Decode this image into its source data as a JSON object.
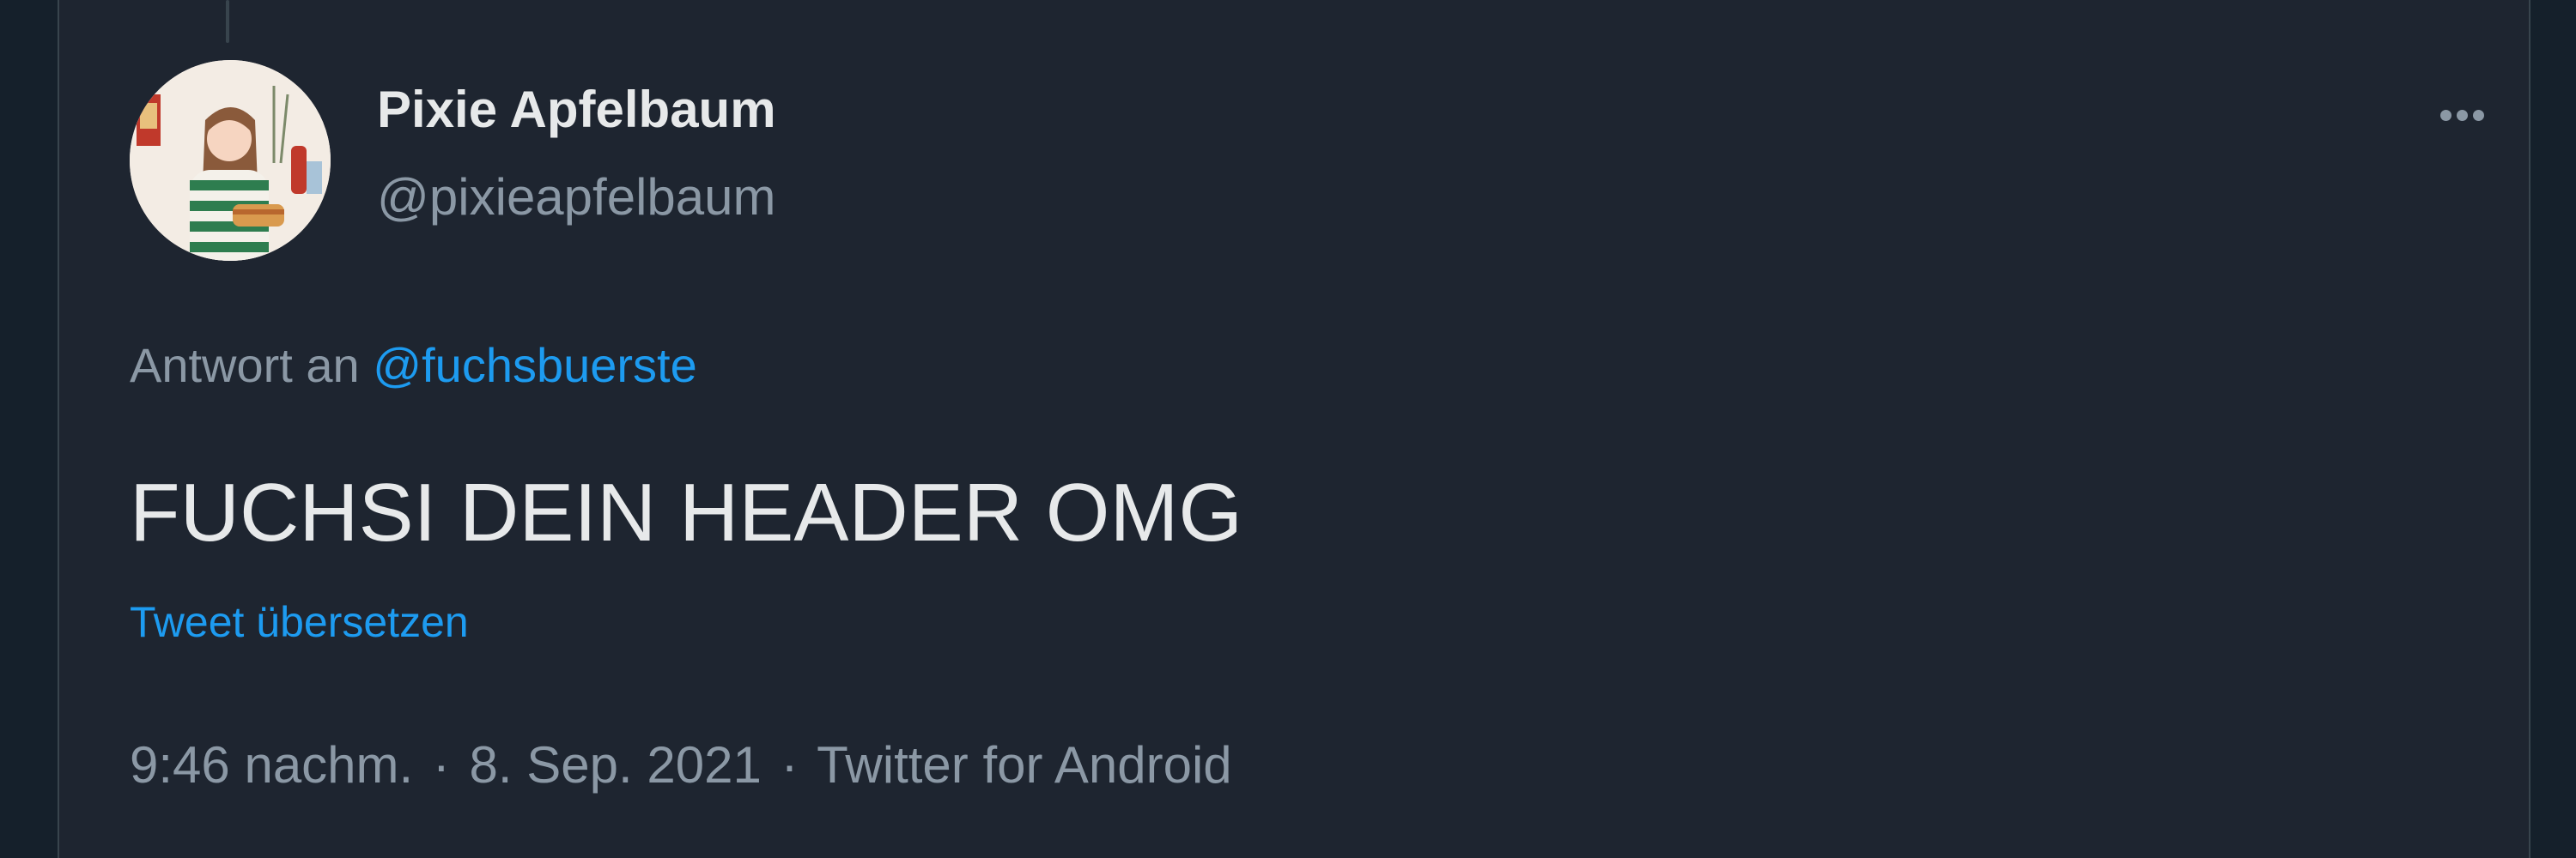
{
  "author": {
    "display_name": "Pixie Apfelbaum",
    "handle": "@pixieapfelbaum"
  },
  "reply": {
    "prefix": "Antwort an",
    "mention": "@fuchsbuerste"
  },
  "tweet": {
    "text": "FUCHSI DEIN HEADER OMG",
    "translate_label": "Tweet übersetzen"
  },
  "meta": {
    "time": "9:46 nachm.",
    "separator": "·",
    "date": "8. Sep. 2021",
    "source": "Twitter for Android"
  },
  "icons": {
    "more": "more-options-icon"
  },
  "colors": {
    "background": "#1e2530",
    "primary_text": "#e7e9ea",
    "secondary_text": "#8b98a5",
    "link": "#1d9bf0"
  }
}
